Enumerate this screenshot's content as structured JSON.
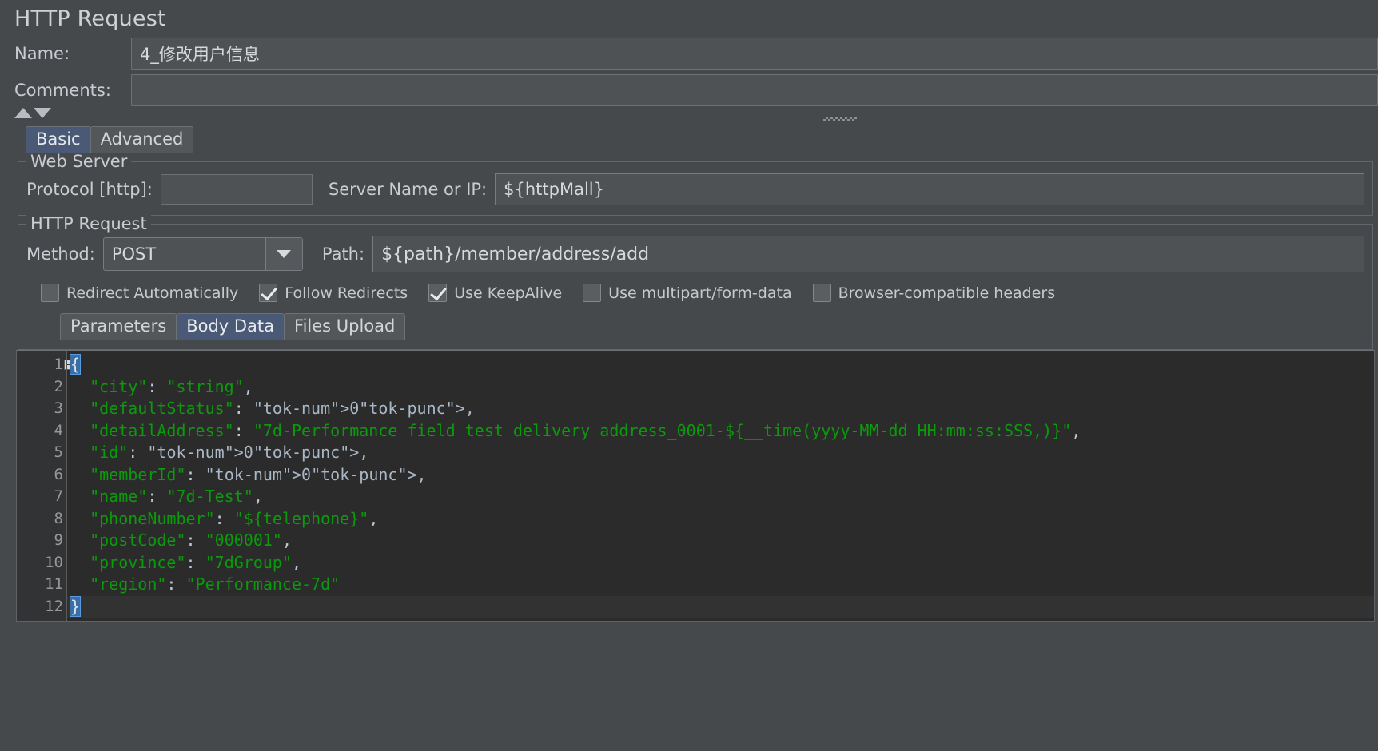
{
  "page_title": "HTTP Request",
  "fields": {
    "name_label": "Name:",
    "name_value": "4_修改用户信息",
    "comments_label": "Comments:",
    "comments_value": ""
  },
  "top_tabs": [
    {
      "label": "Basic",
      "selected": true
    },
    {
      "label": "Advanced",
      "selected": false
    }
  ],
  "web_server": {
    "legend": "Web Server",
    "protocol_label": "Protocol [http]:",
    "protocol_value": "",
    "server_label": "Server Name or IP:",
    "server_value": "${httpMall}"
  },
  "http_request": {
    "legend": "HTTP Request",
    "method_label": "Method:",
    "method_value": "POST",
    "path_label": "Path:",
    "path_value": "${path}/member/address/add",
    "checkboxes": [
      {
        "label": "Redirect Automatically",
        "checked": false
      },
      {
        "label": "Follow Redirects",
        "checked": true
      },
      {
        "label": "Use KeepAlive",
        "checked": true
      },
      {
        "label": "Use multipart/form-data",
        "checked": false
      },
      {
        "label": "Browser-compatible headers",
        "checked": false
      }
    ],
    "inner_tabs": [
      {
        "label": "Parameters",
        "selected": false
      },
      {
        "label": "Body Data",
        "selected": true
      },
      {
        "label": "Files Upload",
        "selected": false
      }
    ]
  },
  "editor": {
    "line_numbers": [
      "1",
      "2",
      "3",
      "4",
      "5",
      "6",
      "7",
      "8",
      "9",
      "10",
      "11",
      "12"
    ],
    "lines": [
      "{",
      "  \"city\": \"string\",",
      "  \"defaultStatus\": 0,",
      "  \"detailAddress\": \"7d-Performance field test delivery address_0001-${__time(yyyy-MM-dd HH:mm:ss:SSS,)}\",",
      "  \"id\": 0,",
      "  \"memberId\": 0,",
      "  \"name\": \"7d-Test\",",
      "  \"phoneNumber\": \"${telephone}\",",
      "  \"postCode\": \"000001\",",
      "  \"province\": \"7dGroup\",",
      "  \"region\": \"Performance-7d\"",
      "}"
    ],
    "fold_marker": "−",
    "cursor_line": 12
  },
  "colors": {
    "background": "#46494c",
    "editor_background": "#2b2b2b",
    "selected_tab": "#4a5a76",
    "string_token": "#0b9a0b",
    "number_token": "#6897bb",
    "brace_highlight": "#3b6ea5"
  }
}
